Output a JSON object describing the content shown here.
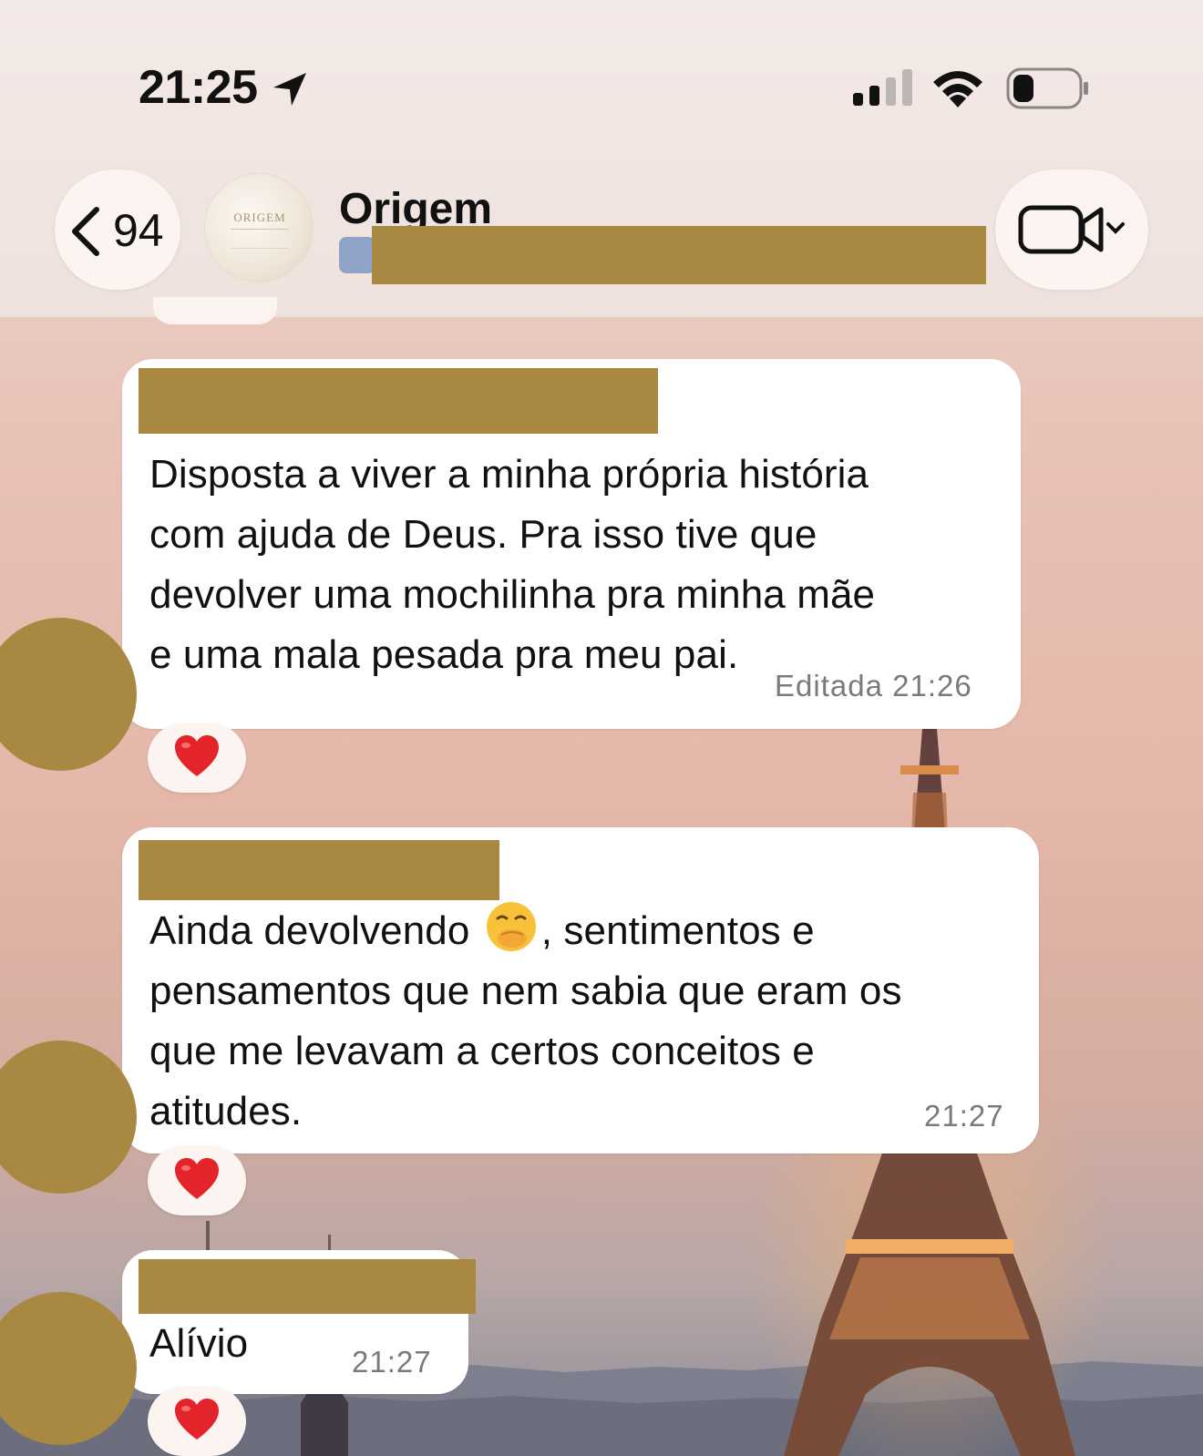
{
  "status_bar": {
    "time": "21:25",
    "icons": [
      "location-arrow-icon",
      "cellular-signal-icon",
      "wifi-icon",
      "battery-icon"
    ]
  },
  "header": {
    "back_count": "94",
    "group_avatar_text": "ORIGEM",
    "title": "Origem",
    "icons": [
      "chevron-left-icon",
      "group-people-icon",
      "video-camera-icon",
      "chevron-down-icon"
    ]
  },
  "messages": [
    {
      "lines": [
        "Disposta a viver a minha própria história",
        "com ajuda de Deus. Pra isso tive que",
        "devolver uma mochilinha pra minha mãe",
        "e uma mala pesada pra meu pai."
      ],
      "edited_label": "Editada",
      "time": "21:26",
      "reaction": "❤️"
    },
    {
      "line1_before": "Ainda devolvendo",
      "emoji_icon": "face-with-hand-over-mouth-icon",
      "line1_after": ", sentimentos e",
      "lines": [
        "pensamentos que nem sabia que eram os",
        "que me levavam a certos conceitos e",
        "atitudes."
      ],
      "time": "21:27",
      "reaction": "❤️"
    },
    {
      "lines": [
        "Alívio"
      ],
      "time": "21:27",
      "reaction": "❤️"
    }
  ],
  "colors": {
    "redaction": "#a98841",
    "bubble": "#ffffff",
    "header_bg": "#efe2dd",
    "wallpaper_top": "#eddbd6",
    "wallpaper_mid": "#e4b7a9"
  }
}
